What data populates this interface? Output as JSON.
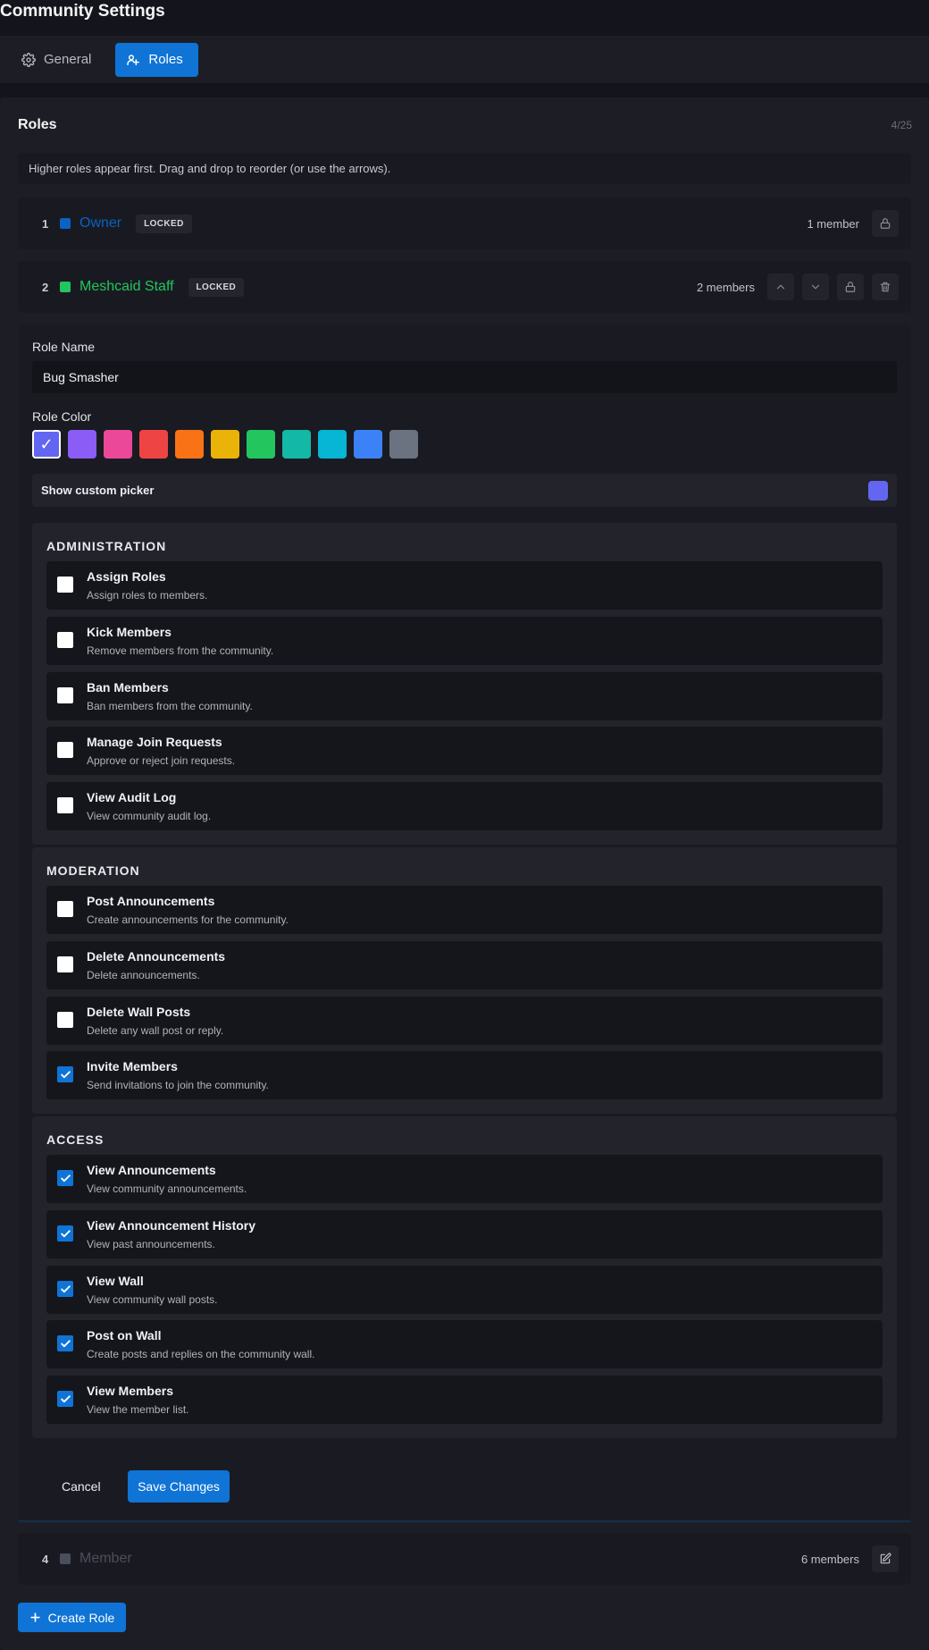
{
  "page": {
    "title": "Community Settings"
  },
  "tabs": [
    {
      "label": "General",
      "icon": "gear-icon"
    },
    {
      "label": "Roles",
      "icon": "roles-icon",
      "active": true
    }
  ],
  "roles_panel": {
    "title": "Roles",
    "count": "4/25",
    "hint": "Higher roles appear first. Drag and drop to reorder (or use the arrows)."
  },
  "roles": [
    {
      "position": "1",
      "name": "Owner",
      "color": "#0a62c2",
      "badge": "LOCKED",
      "members": "1 member"
    },
    {
      "position": "2",
      "name": "Meshcaid Staff",
      "color": "#22c55e",
      "badge": "LOCKED",
      "members": "2 members"
    },
    {
      "position": "4",
      "name": "Member",
      "color": "#4b4f5c",
      "members": "6 members"
    }
  ],
  "editor": {
    "name_label": "Role Name",
    "name_value": "Bug Smasher",
    "color_label": "Role Color",
    "colors": [
      "#6366f1",
      "#8b5cf6",
      "#ec4899",
      "#ef4444",
      "#f97316",
      "#eab308",
      "#22c55e",
      "#14b8a6",
      "#06b6d4",
      "#3b82f6",
      "#6b7280"
    ],
    "selected_color_mark": "✓",
    "custom_picker_label": "Show custom picker",
    "custom_color": "#6366f1",
    "sections": [
      {
        "title": "ADMINISTRATION",
        "items": [
          {
            "title": "Assign Roles",
            "desc": "Assign roles to members.",
            "checked": false
          },
          {
            "title": "Kick Members",
            "desc": "Remove members from the community.",
            "checked": false
          },
          {
            "title": "Ban Members",
            "desc": "Ban members from the community.",
            "checked": false
          },
          {
            "title": "Manage Join Requests",
            "desc": "Approve or reject join requests.",
            "checked": false
          },
          {
            "title": "View Audit Log",
            "desc": "View community audit log.",
            "checked": false
          }
        ]
      },
      {
        "title": "MODERATION",
        "items": [
          {
            "title": "Post Announcements",
            "desc": "Create announcements for the community.",
            "checked": false
          },
          {
            "title": "Delete Announcements",
            "desc": "Delete announcements.",
            "checked": false
          },
          {
            "title": "Delete Wall Posts",
            "desc": "Delete any wall post or reply.",
            "checked": false
          },
          {
            "title": "Invite Members",
            "desc": "Send invitations to join the community.",
            "checked": true
          }
        ]
      },
      {
        "title": "ACCESS",
        "items": [
          {
            "title": "View Announcements",
            "desc": "View community announcements.",
            "checked": true
          },
          {
            "title": "View Announcement History",
            "desc": "View past announcements.",
            "checked": true
          },
          {
            "title": "View Wall",
            "desc": "View community wall posts.",
            "checked": true
          },
          {
            "title": "Post on Wall",
            "desc": "Create posts and replies on the community wall.",
            "checked": true
          },
          {
            "title": "View Members",
            "desc": "View the member list.",
            "checked": true
          }
        ]
      }
    ],
    "cancel_label": "Cancel",
    "save_label": "Save Changes"
  },
  "create_role_label": "Create Role",
  "colors": {
    "accent": "#0f74d6",
    "background": "#14151c",
    "panel": "#1d1e25"
  }
}
